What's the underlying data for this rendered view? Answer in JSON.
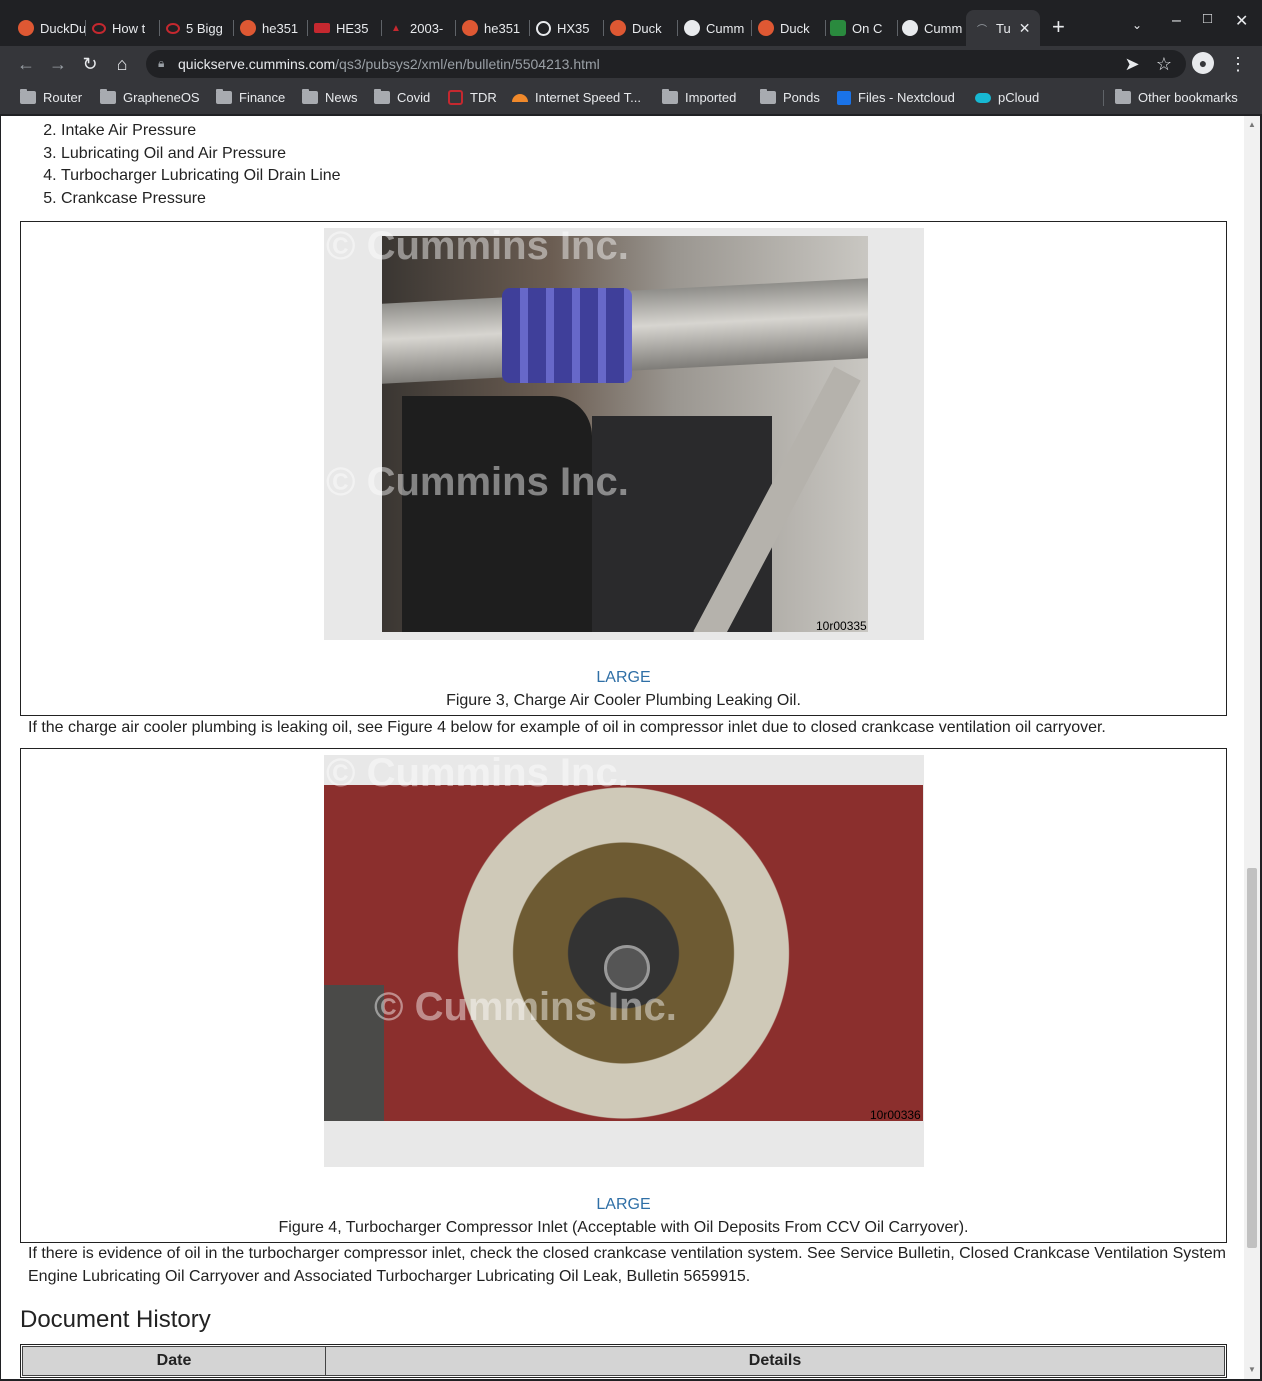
{
  "browser": {
    "tabs": [
      {
        "title": "DuckDuckGo",
        "icon": "duckduckgo-icon"
      },
      {
        "title": "How t",
        "icon": "bank-logo-icon"
      },
      {
        "title": "5 Bigg",
        "icon": "bank-logo-icon"
      },
      {
        "title": "he351",
        "icon": "duckduckgo-icon"
      },
      {
        "title": "HE35",
        "icon": "shop-logo-icon"
      },
      {
        "title": "2003-",
        "icon": "forum-logo-icon"
      },
      {
        "title": "he351",
        "icon": "duckduckgo-icon"
      },
      {
        "title": "HX35",
        "icon": "turbo-logo-icon"
      },
      {
        "title": "Duck",
        "icon": "duckduckgo-icon"
      },
      {
        "title": "Cumm",
        "icon": "globe-icon"
      },
      {
        "title": "Duck",
        "icon": "duckduckgo-icon"
      },
      {
        "title": "On C",
        "icon": "site-logo-icon"
      },
      {
        "title": "Cumm",
        "icon": "globe-icon"
      },
      {
        "title": "Tu",
        "icon": "page-icon"
      }
    ],
    "new_tab_label": "+",
    "url": {
      "host": "quickserve.cummins.com",
      "path": "/qs3/pubsys2/xml/en/bulletin/5504213.html"
    },
    "bookmarks": [
      {
        "label": "Router",
        "icon": "folder-icon"
      },
      {
        "label": "GrapheneOS",
        "icon": "folder-icon"
      },
      {
        "label": "Finance",
        "icon": "folder-icon"
      },
      {
        "label": "News",
        "icon": "folder-icon"
      },
      {
        "label": "Covid",
        "icon": "folder-icon"
      },
      {
        "label": "TDR",
        "icon": "tdr-icon"
      },
      {
        "label": "Internet Speed T...",
        "icon": "speedtest-icon"
      },
      {
        "label": "Imported",
        "icon": "folder-icon"
      },
      {
        "label": "Ponds",
        "icon": "folder-icon"
      },
      {
        "label": "Files - Nextcloud",
        "icon": "nextcloud-icon"
      },
      {
        "label": "pCloud",
        "icon": "pcloud-icon"
      }
    ],
    "other_bookmarks": "Other bookmarks"
  },
  "document": {
    "steps_start": 2,
    "steps": [
      "Intake Air Pressure",
      "Lubricating Oil and Air Pressure",
      "Turbocharger Lubricating Oil Drain Line",
      "Crankcase Pressure"
    ],
    "figure3": {
      "large_link": "LARGE",
      "caption": "Figure 3, Charge Air Cooler Plumbing Leaking Oil.",
      "image_id": "10r00335",
      "watermark": "© Cummins Inc."
    },
    "para1": "If the charge air cooler plumbing is leaking oil, see Figure 4 below for example of oil in compressor inlet due to closed crankcase ventilation oil carryover.",
    "figure4": {
      "large_link": "LARGE",
      "caption": "Figure 4, Turbocharger Compressor Inlet (Acceptable with Oil Deposits From CCV Oil Carryover).",
      "image_id": "10r00336",
      "watermark": "© Cummins Inc."
    },
    "para2": "If there is evidence of oil in the turbocharger compressor inlet, check the closed crankcase ventilation system. See Service Bulletin, Closed Crankcase Ventilation System Engine Lubricating Oil Carryover and Associated Turbocharger Lubricating Oil Leak, Bulletin 5659915.",
    "history_heading": "Document History",
    "history_columns": [
      "Date",
      "Details"
    ]
  }
}
